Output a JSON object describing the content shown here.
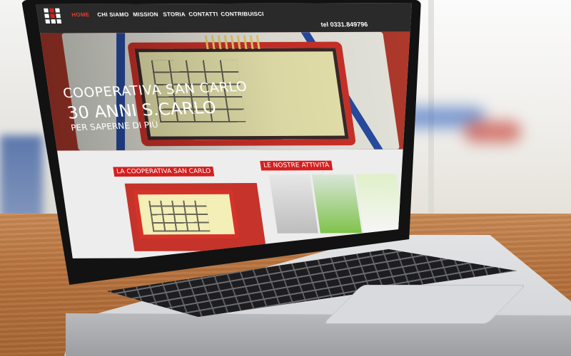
{
  "website": {
    "nav": {
      "items": [
        {
          "label": "HOME",
          "active": true
        },
        {
          "label": "CHI SIAMO",
          "active": false
        },
        {
          "label": "MISSION",
          "active": false
        },
        {
          "label": "STORIA",
          "active": false
        },
        {
          "label": "CONTATTI",
          "active": false
        },
        {
          "label": "CONTRIBUISCI",
          "active": false
        }
      ],
      "phone": "tel 0331.849796"
    },
    "hero": {
      "title": "COOPERATIVA SAN CARLO",
      "subtitle": "30 ANNI S.CARLO",
      "link": "PER SAPERNE DI PIÙ"
    },
    "sections": [
      {
        "title": "LA COOPERATIVA SAN CARLO"
      },
      {
        "title": "LE NOSTRE ATTIVITÀ"
      }
    ]
  },
  "colors": {
    "accent": "#d4201f",
    "navbar": "#2a2a2a"
  },
  "icons": {
    "logo": "square-grid-logo"
  }
}
